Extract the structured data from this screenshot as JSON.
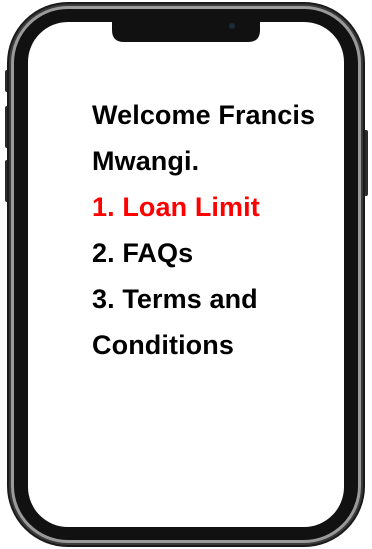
{
  "screen": {
    "greeting_line1": "Welcome Francis",
    "greeting_line2": "Mwangi."
  },
  "menu": {
    "items": [
      {
        "label": "1. Loan Limit",
        "selected": true
      },
      {
        "label": "2. FAQs",
        "selected": false
      },
      {
        "label": "3. Terms and",
        "selected": false
      },
      {
        "label": "Conditions",
        "selected": false
      }
    ]
  },
  "colors": {
    "selected_item": "#ff0000",
    "text": "#000000",
    "screen_background": "#ffffff",
    "phone_frame": "#111111"
  }
}
